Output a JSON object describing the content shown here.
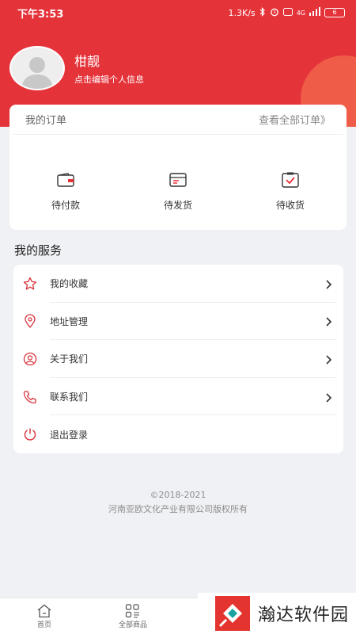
{
  "status_bar": {
    "time": "下午3:53",
    "speed": "1.3K/s",
    "network": "4G",
    "battery": "6"
  },
  "profile": {
    "name": "柑靓",
    "hint": "点击编辑个人信息"
  },
  "orders": {
    "title": "我的订单",
    "view_all": "查看全部订单》",
    "items": [
      {
        "label": "待付款",
        "icon": "wallet-icon"
      },
      {
        "label": "待发货",
        "icon": "package-icon"
      },
      {
        "label": "待收货",
        "icon": "receive-icon"
      }
    ]
  },
  "services": {
    "title": "我的服务",
    "items": [
      {
        "label": "我的收藏",
        "icon": "star-icon"
      },
      {
        "label": "地址管理",
        "icon": "location-icon"
      },
      {
        "label": "关于我们",
        "icon": "user-circle-icon"
      },
      {
        "label": "联系我们",
        "icon": "phone-icon"
      },
      {
        "label": "退出登录",
        "icon": "power-icon"
      }
    ]
  },
  "footer": {
    "copyright": "©2018-2021",
    "company": "河南亚欧文化产业有限公司版权所有"
  },
  "tabbar": {
    "items": [
      {
        "label": "首页",
        "icon": "home-icon"
      },
      {
        "label": "全部商品",
        "icon": "grid-icon"
      }
    ]
  },
  "watermark": {
    "text": "瀚达软件园"
  },
  "colors": {
    "accent": "#e5333a",
    "icon_red": "#d9333b"
  }
}
